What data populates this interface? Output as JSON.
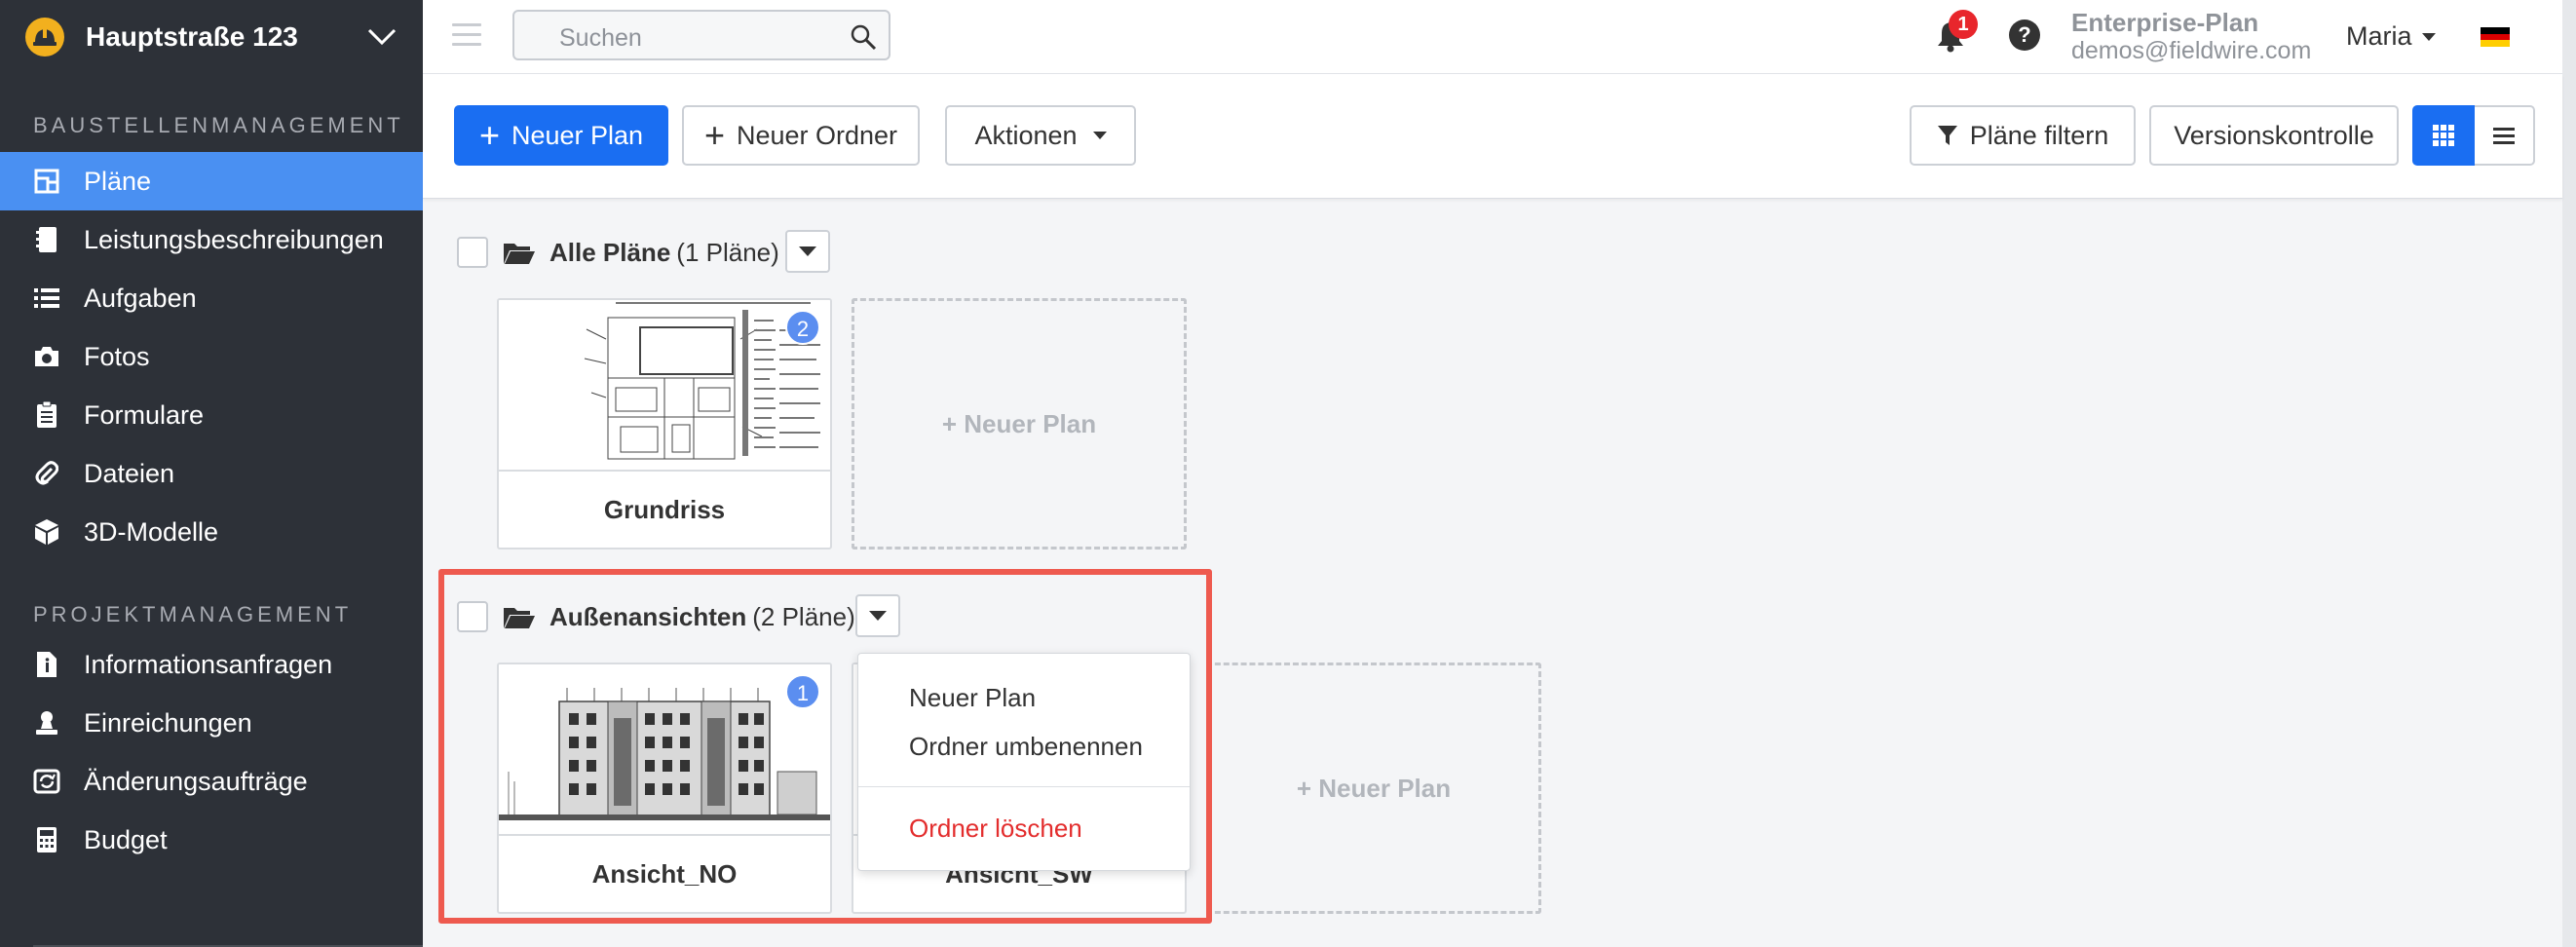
{
  "sidebar": {
    "project_name": "Hauptstraße 123",
    "section1_title": "BAUSTELLENMANAGEMENT",
    "section1_items": [
      {
        "label": "Pläne",
        "icon": "plans-icon"
      },
      {
        "label": "Leistungsbeschreibungen",
        "icon": "notebook-icon"
      },
      {
        "label": "Aufgaben",
        "icon": "list-icon"
      },
      {
        "label": "Fotos",
        "icon": "camera-icon"
      },
      {
        "label": "Formulare",
        "icon": "clipboard-icon"
      },
      {
        "label": "Dateien",
        "icon": "paperclip-icon"
      },
      {
        "label": "3D-Modelle",
        "icon": "cube-icon"
      }
    ],
    "section2_title": "PROJEKTMANAGEMENT",
    "section2_items": [
      {
        "label": "Informationsanfragen",
        "icon": "document-info-icon"
      },
      {
        "label": "Einreichungen",
        "icon": "person-stamp-icon"
      },
      {
        "label": "Änderungsaufträge",
        "icon": "change-order-icon"
      },
      {
        "label": "Budget",
        "icon": "calculator-icon"
      }
    ]
  },
  "topbar": {
    "search_placeholder": "Suchen",
    "notification_count": "1",
    "help_label": "?",
    "plan_name": "Enterprise-Plan",
    "email": "demos@fieldwire.com",
    "user_name": "Maria",
    "flag_colors": [
      "#000000",
      "#dd0000",
      "#ffce00"
    ]
  },
  "toolbar": {
    "new_plan": "Neuer Plan",
    "new_folder": "Neuer Ordner",
    "actions": "Aktionen",
    "filter": "Pläne filtern",
    "version_control": "Versionskontrolle"
  },
  "folders": [
    {
      "name": "Alle Pläne",
      "count": "(1 Pläne)",
      "plans": [
        {
          "label": "Grundriss",
          "badge": "2"
        }
      ],
      "add_label": "+ Neuer Plan"
    },
    {
      "name": "Außenansichten",
      "count": "(2 Pläne)",
      "plans": [
        {
          "label": "Ansicht_NO",
          "badge": "1"
        },
        {
          "label": "Ansicht_SW"
        }
      ],
      "add_label": "+ Neuer Plan"
    }
  ],
  "folder_menu": {
    "new_plan": "Neuer Plan",
    "rename": "Ordner umbenennen",
    "delete": "Ordner löschen"
  },
  "colors": {
    "sidebar_bg": "#2d3138",
    "active_nav": "#4a90f2",
    "primary": "#1a6ef2",
    "highlight": "#ee5a4f",
    "danger": "#e32d2d"
  }
}
